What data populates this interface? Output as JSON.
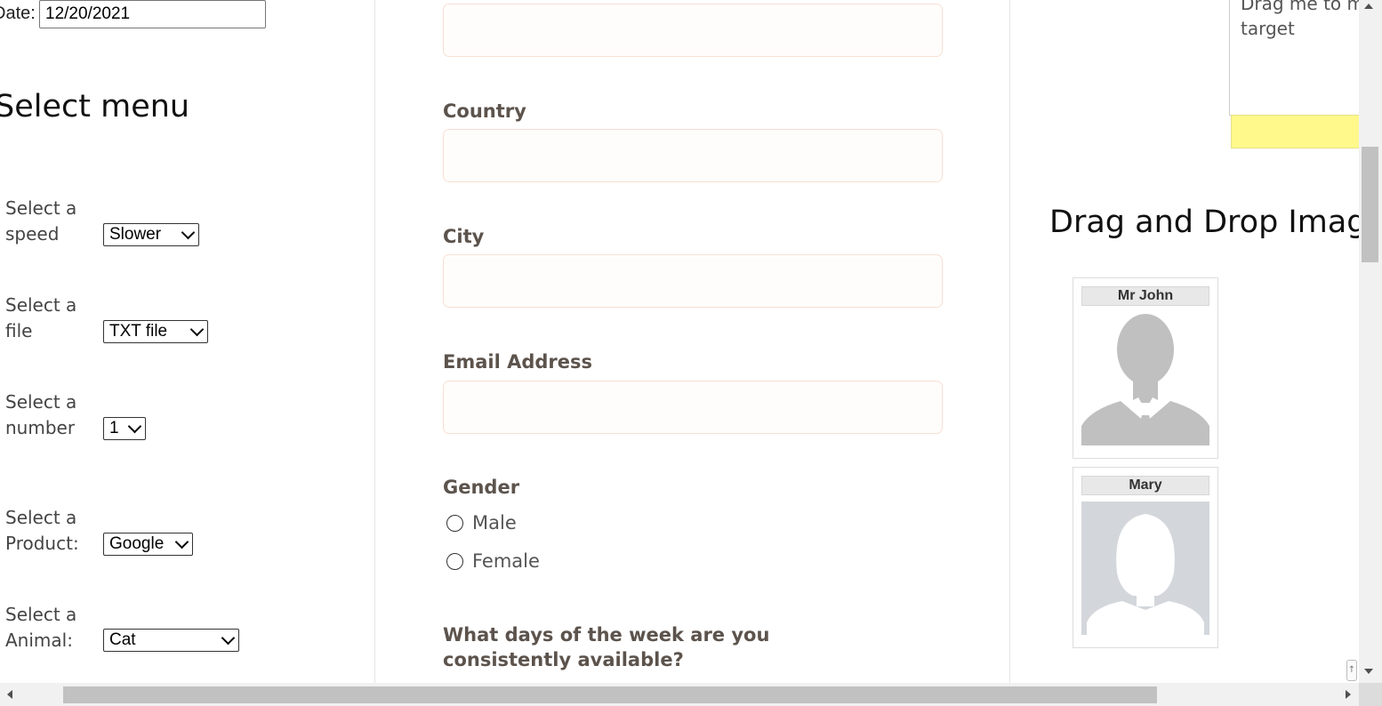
{
  "left": {
    "date_label": "Date:",
    "date_value": "12/20/2021",
    "section_title": "Select menu",
    "selects": [
      {
        "label_line1": "Select a",
        "label_line2": "speed",
        "value": "Slower"
      },
      {
        "label_line1": "Select a",
        "label_line2": "file",
        "value": "TXT file"
      },
      {
        "label_line1": "Select a",
        "label_line2": "number",
        "value": "1"
      },
      {
        "label_line1": "Select a",
        "label_line2": "Product:",
        "value": "Google"
      },
      {
        "label_line1": "Select a",
        "label_line2": "Animal:",
        "value": "Cat"
      }
    ]
  },
  "middle": {
    "fields": [
      {
        "label": "Country"
      },
      {
        "label": "City"
      },
      {
        "label": "Email Address"
      }
    ],
    "gender_label": "Gender",
    "gender_options": [
      "Male",
      "Female"
    ],
    "question": "What days of the week are you consistently available?"
  },
  "right": {
    "drag_text": "Drag me to my target",
    "dd_title": "Drag and Drop Images",
    "cards": [
      {
        "name": "Mr John"
      },
      {
        "name": "Mary"
      }
    ]
  },
  "colors": {
    "field_border": "#f8dfd3",
    "label_brown": "#5c534c",
    "drop_yellow": "#fff98c",
    "silhouette_john": "#c0c0c0",
    "silhouette_mary": "#d3d7dc"
  },
  "icons": [
    "chevron-down-icon",
    "radio-icon",
    "scroll-up-arrow-icon",
    "scroll-down-arrow-icon",
    "scroll-left-arrow-icon",
    "scroll-right-arrow-icon"
  ]
}
